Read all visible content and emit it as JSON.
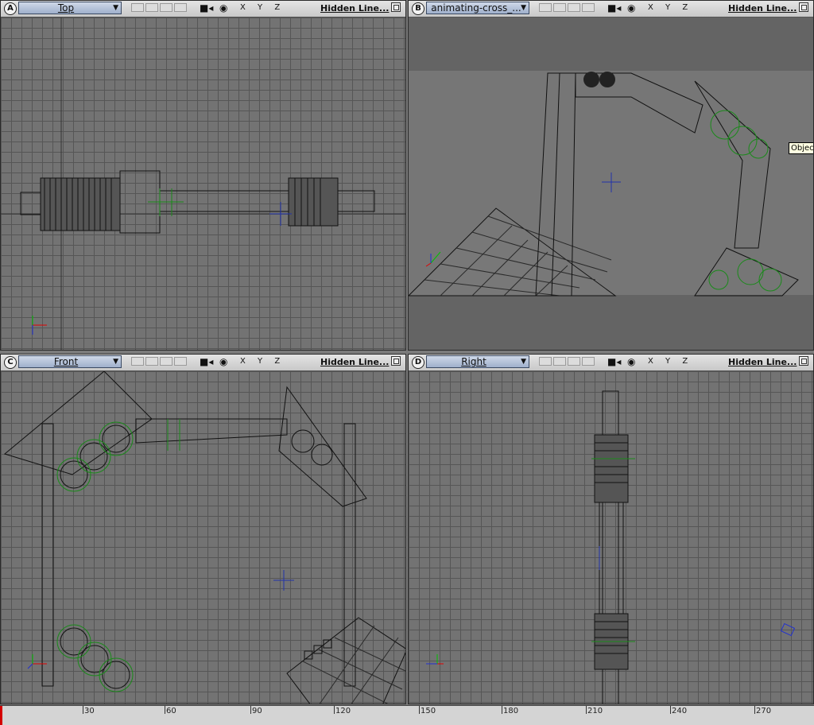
{
  "viewports": [
    {
      "id": "A",
      "camera": "Top",
      "display_mode": "Hidden Line...",
      "axes": "X Y Z"
    },
    {
      "id": "B",
      "camera": "animating-cross_...",
      "display_mode": "Hidden Line...",
      "axes": "X Y Z",
      "tooltip": "Object"
    },
    {
      "id": "C",
      "camera": "Front",
      "display_mode": "Hidden Line...",
      "axes": "X Y Z"
    },
    {
      "id": "D",
      "camera": "Right",
      "display_mode": "Hidden Line...",
      "axes": "X Y Z"
    }
  ],
  "icons": {
    "camera": "camera-icon",
    "visibility": "eye-icon",
    "maximize": "maximize-icon",
    "dropdown": "chevron-down-icon",
    "axis_gizmo": "axis-gizmo-icon"
  },
  "timeline": {
    "ticks": [
      "30",
      "60",
      "90",
      "120",
      "150",
      "180",
      "210",
      "240",
      "270"
    ],
    "current_frame": "0"
  },
  "colors": {
    "viewport_bg": "#737373",
    "grid": "#565656",
    "header": "#d6d6d6",
    "selection": "#1a8a1a",
    "center_marker": "#2233aa",
    "playhead": "#d40000",
    "axis_x": "#e00000",
    "axis_y": "#00c000",
    "axis_z": "#2030d0"
  }
}
